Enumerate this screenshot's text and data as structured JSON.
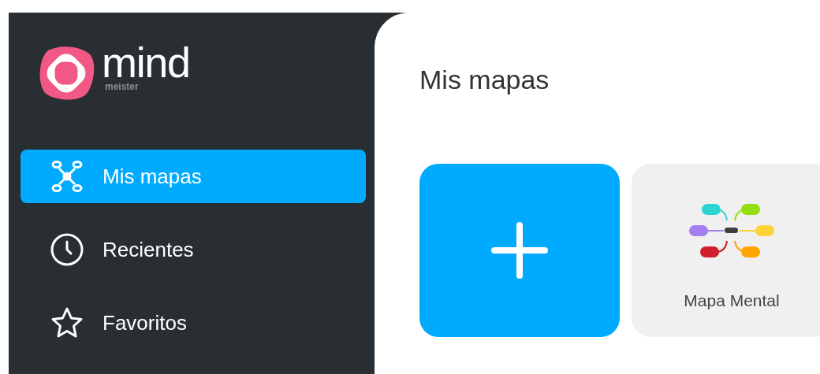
{
  "logo": {
    "name": "mind",
    "subtitle": "meister"
  },
  "sidebar": {
    "items": [
      {
        "kind": "maps",
        "label": "Mis mapas",
        "selected": true
      },
      {
        "kind": "recent",
        "label": "Recientes",
        "selected": false
      },
      {
        "kind": "favorites",
        "label": "Favoritos",
        "selected": false
      }
    ]
  },
  "page_title": "Mis mapas",
  "templates": [
    {
      "label": "Mapa Mental"
    }
  ]
}
